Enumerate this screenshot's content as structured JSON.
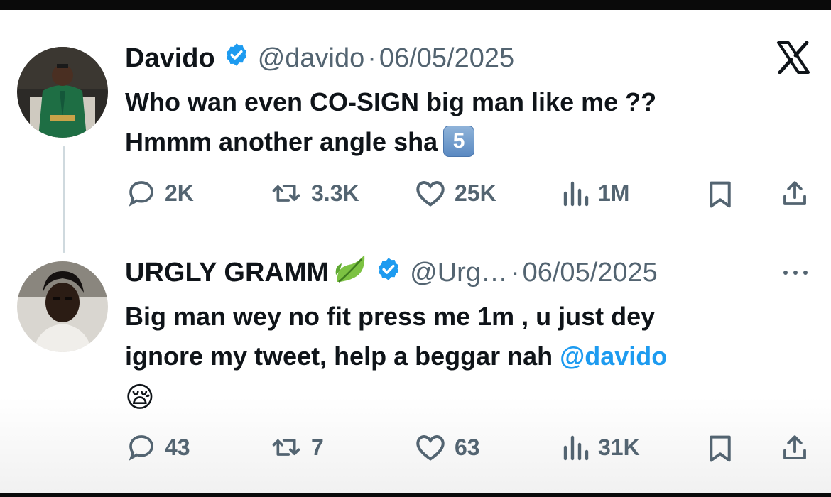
{
  "tweets": [
    {
      "display_name": "Davido",
      "handle": "@davido",
      "separator": "·",
      "date": "06/05/2025",
      "text_line1": "Who wan even CO-SIGN big man like me ??",
      "text_line2": "Hmmm another angle sha",
      "keycap": "5",
      "stats": {
        "replies": "2K",
        "retweets": "3.3K",
        "likes": "25K",
        "views": "1M"
      }
    },
    {
      "display_name": "URGLY GRAMM",
      "handle": "@Urg…",
      "separator": "·",
      "date": "06/05/2025",
      "text_line1": "Big man wey no fit press me 1m , u just dey",
      "text_line2": "ignore my tweet, help a beggar nah ",
      "mention": "@davido",
      "emoji": "😪",
      "stats": {
        "replies": "43",
        "retweets": "7",
        "likes": "63",
        "views": "31K"
      }
    }
  ],
  "icons": {
    "logo": "x-logo-icon",
    "verified": "verified-badge-icon",
    "reply": "reply-icon",
    "retweet": "retweet-icon",
    "like": "heart-icon",
    "views": "views-icon",
    "bookmark": "bookmark-icon",
    "share": "share-icon",
    "more": "more-icon"
  },
  "colors": {
    "accent": "#1d9bf0",
    "muted": "#536471",
    "text": "#0f1419"
  }
}
